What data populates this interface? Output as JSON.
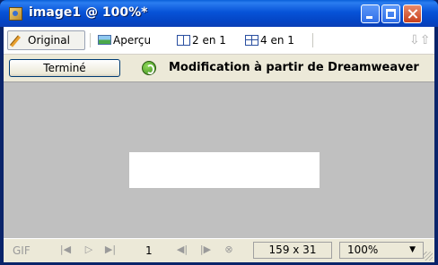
{
  "window": {
    "title": "image1 @ 100%*",
    "accent": "#0a5fd8",
    "icons": [
      "app-icon",
      "minimize-icon",
      "maximize-icon",
      "close-icon"
    ]
  },
  "toolbar": {
    "modes": [
      {
        "label": "Original",
        "icon": "pencil-icon",
        "active": true
      },
      {
        "label": "Aperçu",
        "icon": "picture-icon",
        "active": false
      },
      {
        "label": "2 en 1",
        "icon": "split-2-icon",
        "active": false
      },
      {
        "label": "4 en 1",
        "icon": "split-4-icon",
        "active": false
      }
    ],
    "sort_icon": "sort-arrows-icon"
  },
  "edit_bar": {
    "done_label": "Terminé",
    "message": "Modification à partir de Dreamweaver",
    "icon": "dreamweaver-icon"
  },
  "canvas": {
    "background": "#c0c0c0",
    "image_fill": "#ffffff"
  },
  "status": {
    "format": "GIF",
    "frame": "1",
    "dimensions": "159 x 31",
    "zoom": "100%",
    "nav_icons": [
      "first-frame-icon",
      "play-icon",
      "last-frame-icon",
      "prev-frame-icon",
      "next-frame-icon",
      "stop-icon"
    ]
  }
}
